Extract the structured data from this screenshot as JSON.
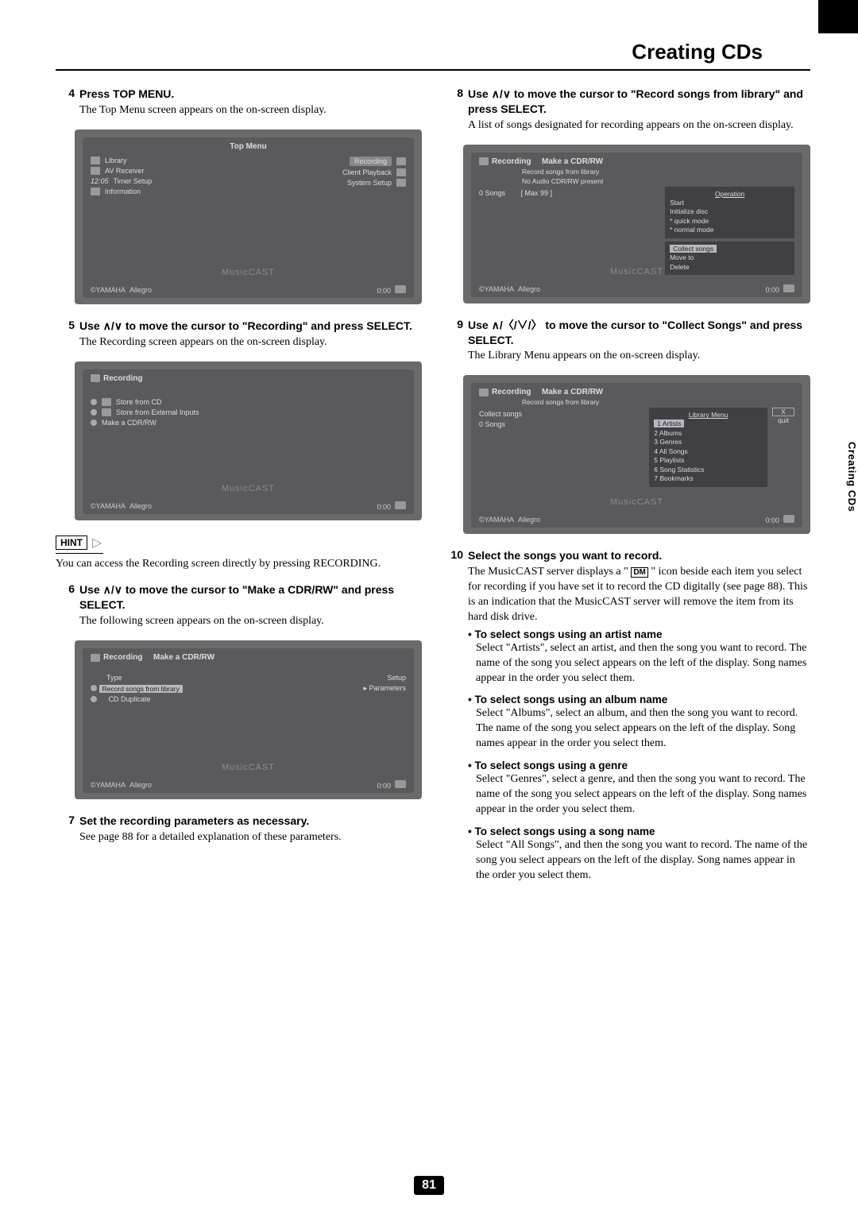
{
  "header": {
    "title": "Creating CDs"
  },
  "sideTab": "Creating CDs",
  "pageNumber": "81",
  "symbols": {
    "upDown": "∧/∨",
    "upLeftDownRight": "∧/〈/∨/〉",
    "dm": "DM"
  },
  "hint": {
    "label": "HINT",
    "text": "You can access the Recording screen directly by pressing RECORDING."
  },
  "left": {
    "steps": [
      {
        "num": "4",
        "head": "Press TOP MENU.",
        "text": "The Top Menu screen appears on the on-screen display."
      },
      {
        "num": "5",
        "headPrefix": "Use ",
        "headMid": " to move the cursor to \"Recording\" and press SELECT.",
        "text": "The Recording screen appears on the on-screen display."
      },
      {
        "num": "6",
        "headPrefix": "Use ",
        "headMid": " to move the cursor to \"Make a CDR/RW\" and press SELECT.",
        "text": "The following screen appears on the on-screen display."
      },
      {
        "num": "7",
        "head": "Set the recording parameters as necessary.",
        "text": "See page 88 for a detailed explanation of these parameters."
      }
    ],
    "ss1": {
      "title": "Top Menu",
      "items": [
        "Library",
        "AV Receiver",
        "Timer Setup",
        "Information"
      ],
      "rightItems": [
        "Recording",
        "Client Playback",
        "System Setup"
      ],
      "brand": "©YAMAHA",
      "track": "Allegro",
      "time": "0:00",
      "watermark": "MusicCAST",
      "clock": "12:05"
    },
    "ss2": {
      "title": "Recording",
      "items": [
        "Store from CD",
        "Store from External Inputs",
        "Make a CDR/RW"
      ],
      "brand": "©YAMAHA",
      "track": "Allegro",
      "time": "0:00",
      "watermark": "MusicCAST"
    },
    "ss3": {
      "crumb1": "Recording",
      "crumb2": "Make a CDR/RW",
      "typeLabel": "Type",
      "setupLabel": "Setup",
      "items": [
        "Record songs from library",
        "CD Duplicate"
      ],
      "paramLabel": "Parameters",
      "brand": "©YAMAHA",
      "track": "Allegro",
      "time": "0:00",
      "watermark": "MusicCAST"
    }
  },
  "right": {
    "steps": [
      {
        "num": "8",
        "headPrefix": "Use ",
        "headMid": " to move the cursor to \"Record songs from library\" and press SELECT.",
        "text": "A list of songs designated for recording appears on the on-screen display."
      },
      {
        "num": "9",
        "headPrefix": "Use ",
        "headMid": " to move the cursor to \"Collect Songs\" and press SELECT.",
        "text": "The Library Menu appears on the on-screen display."
      },
      {
        "num": "10",
        "head": "Select the songs you want to record.",
        "textA": "The MusicCAST server displays a \" ",
        "textB": " \" icon beside each item you select for recording if you have set it to record the CD digitally (see page 88). This is an indication that the MusicCAST server will remove the item from its hard disk drive."
      }
    ],
    "ss4": {
      "crumb1": "Recording",
      "crumb2": "Make a CDR/RW",
      "crumb3": "Record songs from library",
      "status": "No Audio CDR/RW present",
      "songs": "0  Songs",
      "max": "[  Max 99  ]",
      "opTitle": "Operation",
      "ops": [
        "Start",
        "Initialize disc",
        "* quick mode",
        "* normal mode"
      ],
      "ops2": [
        "Collect songs",
        "Move to",
        "Delete"
      ],
      "brand": "©YAMAHA",
      "track": "Allegro",
      "time": "0:00",
      "watermark": "MusicCAST"
    },
    "ss5": {
      "crumb1": "Recording",
      "crumb2": "Make a CDR/RW",
      "crumb3": "Record songs from library",
      "collect": "Collect songs",
      "libMenu": "Library Menu",
      "songs": "0  Songs",
      "items": [
        "1  Artists",
        "2  Albums",
        "3  Genres",
        "4  All Songs",
        "5  Playlists",
        "6  Song Statistics",
        "7  Bookmarks"
      ],
      "quit": "quit",
      "x": "X",
      "brand": "©YAMAHA",
      "track": "Allegro",
      "time": "0:00",
      "watermark": "MusicCAST"
    },
    "bullets": [
      {
        "head": "To select songs using an artist name",
        "body": "Select \"Artists\", select an artist, and then the song you want to record. The name of the song you select appears on the left of the display. Song names appear in the order you select them."
      },
      {
        "head": "To select songs using an album name",
        "body": "Select \"Albums\", select an album, and then the song you want to record. The name of the song you select appears on the left of the display. Song names appear in the order you select them."
      },
      {
        "head": "To select songs using a genre",
        "body": "Select \"Genres\", select a genre, and then the song you want to record. The name of the song you select appears on the left of the display. Song names appear in the order you select them."
      },
      {
        "head": "To select songs using a song name",
        "body": "Select \"All Songs\", and then the song you want to record. The name of the song you select appears on the left of the display. Song names appear in the order you select them."
      }
    ]
  }
}
